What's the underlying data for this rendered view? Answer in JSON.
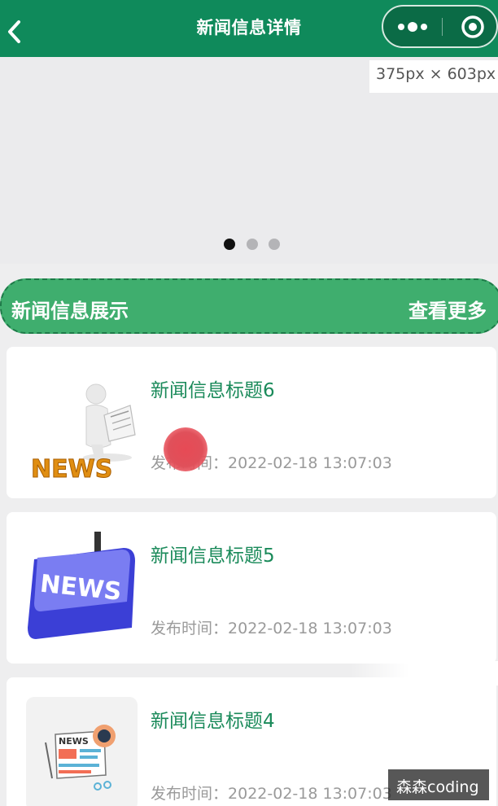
{
  "navbar": {
    "title": "新闻信息详情",
    "back_icon": "chevron-left-icon",
    "capsule": {
      "more_icon": "more-dots-icon",
      "close_icon": "target-circle-icon"
    }
  },
  "size_tag": "375px × 603px",
  "banner": {
    "dots": 3,
    "active_dot": 0
  },
  "section": {
    "title": "新闻信息展示",
    "more_label": "查看更多"
  },
  "news": [
    {
      "title": "新闻信息标题6",
      "time_label": "发布时间：",
      "time": "2022-02-18 13:07:03",
      "image": "news-3d-figure-image"
    },
    {
      "title": "新闻信息标题5",
      "time_label": "发布时间：",
      "time": "2022-02-18 13:07:03",
      "image": "news-key-image"
    },
    {
      "title": "新闻信息标题4",
      "time_label": "发布时间：",
      "time": "2022-02-18 13:07:03",
      "image": "newspaper-illustration-image"
    }
  ],
  "watermark": "森森coding",
  "colors": {
    "navbar": "#0f8a5b",
    "section": "#3fae6e",
    "title_green": "#1a8a5a",
    "time_gray": "#9a9a9a"
  }
}
